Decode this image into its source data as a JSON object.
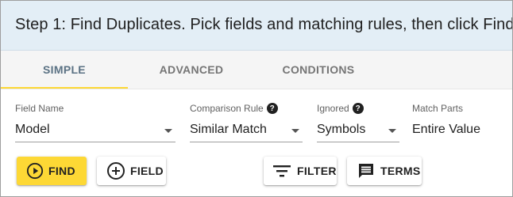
{
  "header": {
    "title": "Step 1: Find Duplicates. Pick fields and matching rules, then click Find"
  },
  "tabs": [
    {
      "label": "SIMPLE",
      "active": true
    },
    {
      "label": "ADVANCED",
      "active": false
    },
    {
      "label": "CONDITIONS",
      "active": false
    }
  ],
  "fields": {
    "field_name": {
      "label": "Field Name",
      "value": "Model"
    },
    "comparison_rule": {
      "label": "Comparison Rule",
      "value": "Similar Match"
    },
    "ignored": {
      "label": "Ignored",
      "value": "Symbols"
    },
    "match_parts": {
      "label": "Match Parts",
      "value": "Entire Value"
    }
  },
  "help_glyph": "?",
  "buttons": {
    "find": {
      "label": "FIND",
      "icon": "play-circle-icon"
    },
    "field": {
      "label": "FIELD",
      "icon": "add-circle-icon"
    },
    "filter": {
      "label": "FILTER",
      "icon": "filter-list-icon"
    },
    "terms": {
      "label": "TERMS",
      "icon": "message-icon"
    }
  },
  "colors": {
    "header_bg": "#e3eef6",
    "tab_indicator": "#fdd835",
    "find_button": "#fdd835",
    "active_tab_text": "#5a7183"
  }
}
